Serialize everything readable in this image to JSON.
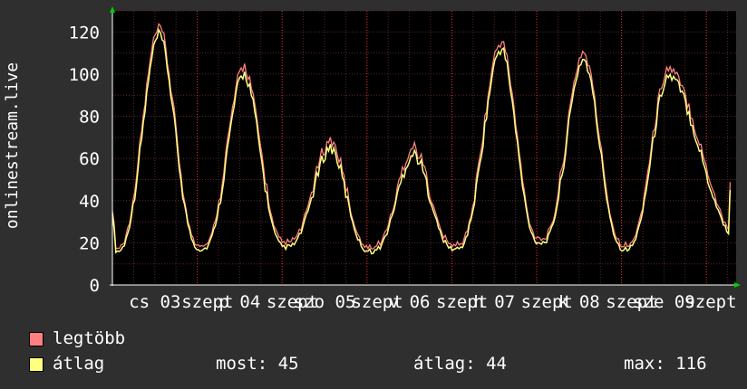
{
  "chart_data": {
    "type": "line",
    "ylabel": "onlinestream.live",
    "ylim": [
      0,
      130
    ],
    "y_ticks": [
      0,
      20,
      40,
      60,
      80,
      100,
      120
    ],
    "x_ticks": [
      "cs 03",
      "szept",
      "p 04",
      "szept",
      "szo 05",
      "szept",
      "v 06",
      "szept",
      "h 07",
      "szept",
      "k 08",
      "szept",
      "sze 09",
      "szept"
    ],
    "x_tick_texts": [
      {
        "label": "cs 03",
        "pos": 0.5
      },
      {
        "label": "szept",
        "pos": 1.12
      },
      {
        "label": "p 04",
        "pos": 1.5
      },
      {
        "label": "szept",
        "pos": 2.12
      },
      {
        "label": "szo 05",
        "pos": 2.5
      },
      {
        "label": "szept",
        "pos": 3.12
      },
      {
        "label": "v 06",
        "pos": 3.5
      },
      {
        "label": "szept",
        "pos": 4.12
      },
      {
        "label": "h 07",
        "pos": 4.5
      },
      {
        "label": "szept",
        "pos": 5.12
      },
      {
        "label": "k 08",
        "pos": 5.5
      },
      {
        "label": "szept",
        "pos": 6.12
      },
      {
        "label": "sze 09",
        "pos": 6.5
      },
      {
        "label": "szept",
        "pos": 7.05
      }
    ],
    "grid": true,
    "x_range": [
      0,
      7.35
    ],
    "peaks": [
      {
        "x": 0.55,
        "y": 118
      },
      {
        "x": 1.55,
        "y": 100
      },
      {
        "x": 2.57,
        "y": 65
      },
      {
        "x": 3.55,
        "y": 62
      },
      {
        "x": 4.58,
        "y": 112
      },
      {
        "x": 5.55,
        "y": 107
      },
      {
        "x": 6.55,
        "y": 99
      }
    ],
    "troughs": [
      {
        "x": 0.05,
        "y": 16
      },
      {
        "x": 1.05,
        "y": 17
      },
      {
        "x": 2.05,
        "y": 18
      },
      {
        "x": 3.05,
        "y": 16
      },
      {
        "x": 4.05,
        "y": 17
      },
      {
        "x": 5.05,
        "y": 20
      },
      {
        "x": 6.05,
        "y": 17
      }
    ],
    "start": {
      "x": 0,
      "y": 35
    },
    "end": {
      "x": 7.28,
      "y": 45
    },
    "series": [
      {
        "name": "legtöbb",
        "color": "#ff8080"
      },
      {
        "name": "átlag",
        "color": "#ffff80"
      }
    ]
  },
  "stats": {
    "most": "most: 45",
    "atlag": "átlag: 44",
    "max": "max: 116"
  },
  "colors": {
    "background": "#2f2f2f",
    "plot_background": "#000000",
    "grid": "#5a2828",
    "axis": "#ffffff",
    "arrow": "#00cc00"
  }
}
